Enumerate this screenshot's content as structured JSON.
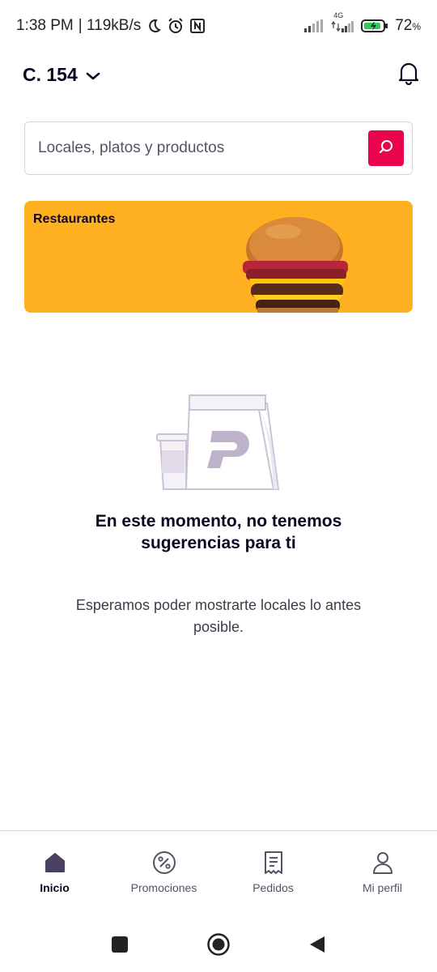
{
  "status_bar": {
    "time": "1:38 PM",
    "net_speed": "| 119kB/s",
    "battery": "72",
    "battery_unit": "%",
    "network": "4G",
    "icons": [
      "moon-icon",
      "alarm-icon",
      "nfc-icon",
      "signal-icon",
      "battery-icon"
    ]
  },
  "header": {
    "address": "C. 154",
    "icons": [
      "chevron-down-icon",
      "bell-icon"
    ]
  },
  "search": {
    "placeholder": "Locales, platos y productos",
    "value": ""
  },
  "banner": {
    "title": "Restaurantes"
  },
  "empty_state": {
    "title": "En este momento, no tenemos sugerencias para ti",
    "subtitle": "Esperamos poder mostrarte locales lo antes posible."
  },
  "bottom_nav": {
    "items": [
      {
        "label": "Inicio",
        "icon": "home-icon",
        "active": true
      },
      {
        "label": "Promociones",
        "icon": "percent-icon",
        "active": false
      },
      {
        "label": "Pedidos",
        "icon": "receipt-icon",
        "active": false
      },
      {
        "label": "Mi perfil",
        "icon": "user-icon",
        "active": false
      }
    ]
  },
  "colors": {
    "accent": "#ea044e",
    "banner": "#ffb020",
    "text_primary": "#100423",
    "illustration": "#cbc2d6"
  }
}
